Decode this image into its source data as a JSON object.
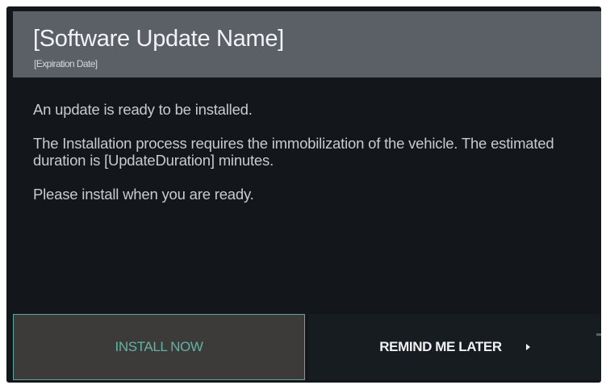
{
  "dialog": {
    "title": "[Software Update Name]",
    "subtitle": "[Expiration Date]",
    "paragraphs": [
      "An update is ready to be installed.",
      "The Installation process requires the immobilization of the vehicle. The estimated duration is [UpdateDuration] minutes.",
      "Please install when you are ready."
    ]
  },
  "buttons": {
    "install_label": "INSTALL NOW",
    "remind_label": "REMIND ME LATER",
    "remind_icon": "chevron-right-icon"
  },
  "colors": {
    "background": "#13171b",
    "header": "#5b6066",
    "accent": "#63b2a3",
    "install_bg": "#3c3b3a",
    "remind_bg": "#171c21"
  }
}
